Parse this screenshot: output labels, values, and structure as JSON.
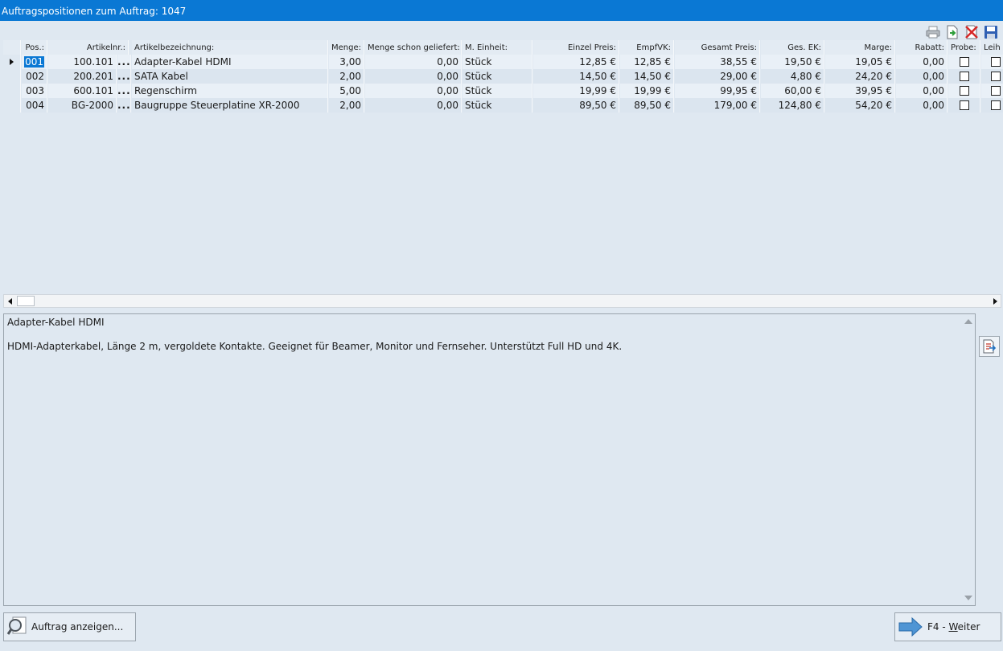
{
  "window": {
    "title": "Auftragspositionen zum Auftrag: 1047"
  },
  "toolbar": {
    "icons": [
      "printer-icon",
      "export-icon",
      "delete-icon",
      "save-icon"
    ]
  },
  "table": {
    "headers": {
      "pos": "Pos.:",
      "artikelnr": "Artikelnr.:",
      "bezeichnung": "Artikelbezeichnung:",
      "menge": "Menge:",
      "geliefert": "Menge schon geliefert:",
      "einheit": "M. Einheit:",
      "einzel": "Einzel Preis:",
      "empfvk": "EmpfVK:",
      "gesamt": "Gesamt Preis:",
      "gesek": "Ges. EK:",
      "marge": "Marge:",
      "rabatt": "Rabatt:",
      "probe": "Probe:",
      "leih": "Leih"
    },
    "rows": [
      {
        "pos": "001",
        "artikelnr": "100.101",
        "ellipsis": "...",
        "bezeichnung": "Adapter-Kabel HDMI",
        "menge": "3,00",
        "geliefert": "0,00",
        "einheit": "Stück",
        "einzel": "12,85 €",
        "empfvk": "12,85 €",
        "gesamt": "38,55 €",
        "gesek": "19,50 €",
        "marge": "19,05 €",
        "rabatt": "0,00",
        "probe": false,
        "leih": false
      },
      {
        "pos": "002",
        "artikelnr": "200.201",
        "ellipsis": "...",
        "bezeichnung": "SATA Kabel",
        "menge": "2,00",
        "geliefert": "0,00",
        "einheit": "Stück",
        "einzel": "14,50 €",
        "empfvk": "14,50 €",
        "gesamt": "29,00 €",
        "gesek": "4,80 €",
        "marge": "24,20 €",
        "rabatt": "0,00",
        "probe": false,
        "leih": false
      },
      {
        "pos": "003",
        "artikelnr": "600.101",
        "ellipsis": "...",
        "bezeichnung": "Regenschirm",
        "menge": "5,00",
        "geliefert": "0,00",
        "einheit": "Stück",
        "einzel": "19,99 €",
        "empfvk": "19,99 €",
        "gesamt": "99,95 €",
        "gesek": "60,00 €",
        "marge": "39,95 €",
        "rabatt": "0,00",
        "probe": false,
        "leih": false
      },
      {
        "pos": "004",
        "artikelnr": "BG-2000",
        "ellipsis": "...",
        "bezeichnung": "Baugruppe Steuerplatine XR-2000",
        "menge": "2,00",
        "geliefert": "0,00",
        "einheit": "Stück",
        "einzel": "89,50 €",
        "empfvk": "89,50 €",
        "gesamt": "179,00 €",
        "gesek": "124,80 €",
        "marge": "54,20 €",
        "rabatt": "0,00",
        "probe": false,
        "leih": false
      }
    ],
    "selected_row": 0
  },
  "description": {
    "title": "Adapter-Kabel HDMI",
    "body": "HDMI-Adapterkabel, Länge 2 m, vergoldete Kontakte. Geeignet für Beamer, Monitor und Fernseher. Unterstützt Full HD und 4K."
  },
  "buttons": {
    "show_order": "Auftrag anzeigen...",
    "next_key": "F4 - ",
    "next_label_underlined": "W",
    "next_label_rest": "eiter"
  }
}
